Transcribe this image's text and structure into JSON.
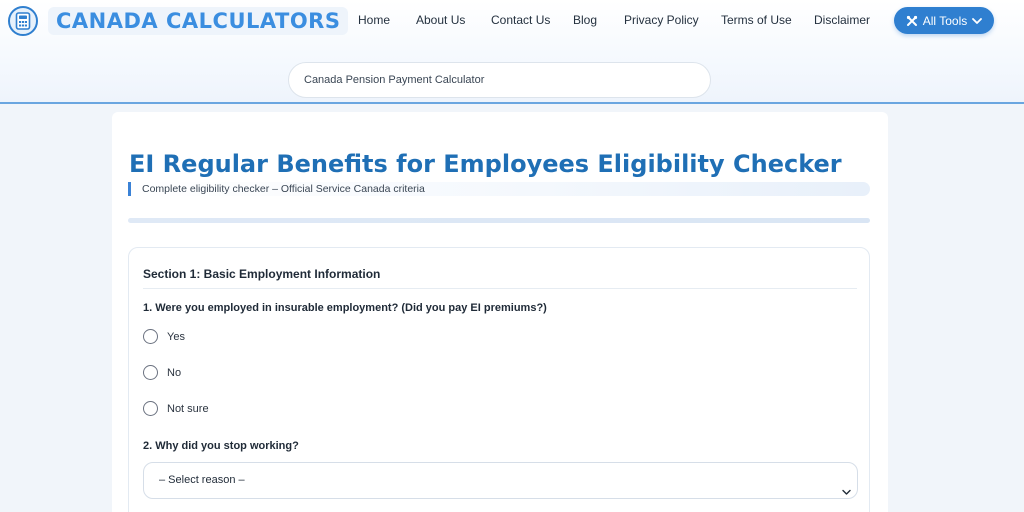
{
  "brand": {
    "name": "CANADA CALCULATORS",
    "icon": "calculator-icon"
  },
  "nav": {
    "items": [
      {
        "label": "Home"
      },
      {
        "label": "About Us"
      },
      {
        "label": "Contact Us"
      },
      {
        "label": "Blog"
      },
      {
        "label": "Privacy Policy"
      },
      {
        "label": "Terms of Use"
      },
      {
        "label": "Disclaimer"
      }
    ],
    "all_tools": {
      "label": "All Tools",
      "icon": "tools-icon",
      "chevron": "chevron-down-icon"
    }
  },
  "search": {
    "value": "Canada Pension Payment Calculator"
  },
  "page": {
    "title": "EI Regular Benefits for Employees Eligibility Checker",
    "subtitle": "Complete eligibility checker – Official Service Canada criteria"
  },
  "section1": {
    "title": "Section 1: Basic Employment Information",
    "q1": {
      "text": "1. Were you employed in insurable employment? (Did you pay EI premiums?)",
      "options": [
        "Yes",
        "No",
        "Not sure"
      ]
    },
    "q2": {
      "text": "2. Why did you stop working?",
      "select_value": "– Select reason –"
    }
  },
  "colors": {
    "brand_blue": "#3b8ee0",
    "title_blue": "#1f6fb5",
    "button_blue": "#2f7fd0",
    "header_border": "#6aa6e0"
  }
}
